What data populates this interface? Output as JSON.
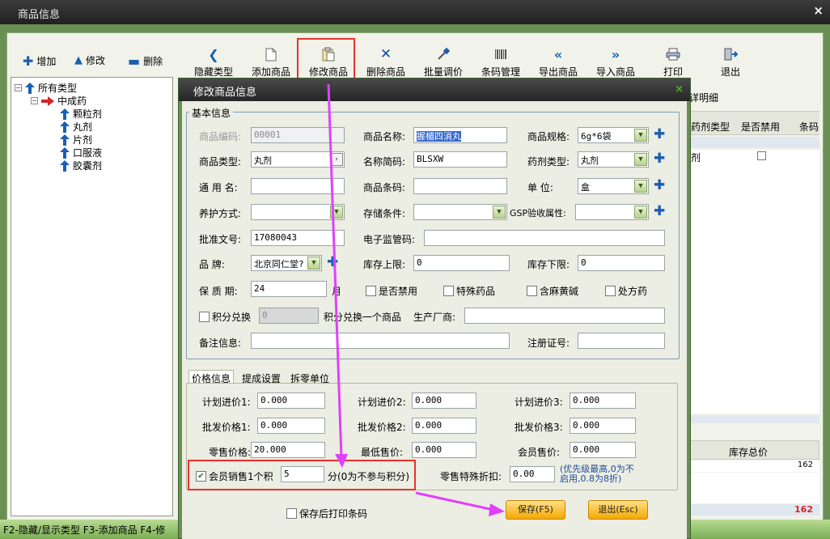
{
  "window": {
    "title": "商品信息",
    "close": "×"
  },
  "side_toolbar": {
    "add": "增加",
    "edit": "修改",
    "delete": "删除"
  },
  "toolbar": {
    "hide_types": "隐藏类型",
    "add_product": "添加商品",
    "edit_product": "修改商品",
    "delete_product": "删除商品",
    "batch_price": "批量调价",
    "barcode": "条码管理",
    "export": "导出商品",
    "import": "导入商品",
    "print": "打印",
    "exit": "退出"
  },
  "tree": {
    "root": "所有类型",
    "child": "中成药",
    "leaves": [
      "颗粒剂",
      "丸剂",
      "片剂",
      "口服液",
      "胶囊剂"
    ]
  },
  "background_grid": {
    "tab_label": "详明细",
    "col_dose_type": "药剂类型",
    "col_disabled": "是否禁用",
    "col_barcode": "条码",
    "row1_dose_type": "剂",
    "stock_total_header": "库存总价",
    "stock_total_value": "162",
    "stock_total_footer": "162"
  },
  "dialog": {
    "title": "修改商品信息",
    "close": "×",
    "basic_group": "基本信息",
    "fields": {
      "code_label": "商品编码:",
      "code": "00001",
      "name_label": "商品名称:",
      "name": "握楣四消丸",
      "spec_label": "商品规格:",
      "spec": "6g*6袋",
      "type_label": "商品类型:",
      "type": "丸剂",
      "abbr_label": "名称简码:",
      "abbr": "BLSXW",
      "dose_label": "药剂类型:",
      "dose": "丸剂",
      "generic_label": "通 用 名:",
      "generic": "",
      "barcode_label": "商品条码:",
      "barcode": "",
      "unit_label": "单    位:",
      "unit": "盒",
      "care_label": "养护方式:",
      "care": "",
      "storage_label": "存储条件:",
      "storage": "",
      "gsp_label": "GSP验收属性:",
      "gsp": "",
      "approval_label": "批准文号:",
      "approval": "17080043",
      "supervision_label": "电子监管码:",
      "supervision": "",
      "brand_label": "品    牌:",
      "brand": "北京同仁堂?",
      "stock_max_label": "库存上限:",
      "stock_max": "0",
      "stock_min_label": "库存下限:",
      "stock_min": "0",
      "shelf_label": "保 质 期:",
      "shelf": "24",
      "shelf_unit": "月",
      "chk_disabled": "是否禁用",
      "chk_special": "特殊药品",
      "chk_ephedrine": "含麻黄碱",
      "chk_rx": "处方药",
      "chk_points": "积分兑换",
      "points_value": "0",
      "points_desc": "积分兑换一个商品",
      "maker_label": "生产厂商:",
      "maker": "",
      "remark_label": "备注信息:",
      "remark": "",
      "reg_label": "注册证号:",
      "reg": ""
    },
    "tabs": [
      "价格信息",
      "提成设置",
      "拆零单位"
    ],
    "price": {
      "plan1_label": "计划进价1:",
      "plan1": "0.000",
      "plan2_label": "计划进价2:",
      "plan2": "0.000",
      "plan3_label": "计划进价3:",
      "plan3": "0.000",
      "whole1_label": "批发价格1:",
      "whole1": "0.000",
      "whole2_label": "批发价格2:",
      "whole2": "0.000",
      "whole3_label": "批发价格3:",
      "whole3": "0.000",
      "retail_label": "零售价格:",
      "retail": "20.000",
      "min_label": "最低售价:",
      "min": "0.000",
      "member_label": "会员售价:",
      "member": "0.000"
    },
    "member_points": {
      "label": "会员销售1个积",
      "value": "5",
      "suffix": "分(0为不参与积分)"
    },
    "discount": {
      "label": "零售特殊折扣:",
      "value": "0.00",
      "note": "(优先级最高,0为不启用,0.8为8折)"
    },
    "print_after_save": "保存后打印条码",
    "save": "保存(F5)",
    "cancel": "退出(Esc)"
  },
  "statusbar": "F2-隐藏/显示类型  F3-添加商品  F4-修",
  "colors": {
    "accent_green": "#6a8f52",
    "highlight_red": "#e8332b",
    "arrow_magenta": "#e040fb",
    "save_orange": "#f5a800"
  }
}
